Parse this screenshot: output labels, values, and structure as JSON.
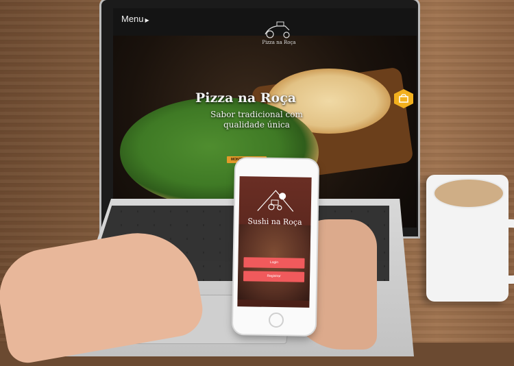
{
  "desktop_site": {
    "menu_label": "Menu",
    "brand": "Pizza na Roça",
    "hero_title": "Pizza na Roça",
    "hero_subtitle": "Sabor tradicional com qualidade única",
    "cta_label": "MONTE SUA PIZZA"
  },
  "mobile_app": {
    "brand": "Sushi na Roça",
    "login_label": "Login",
    "register_label": "Registrar"
  },
  "colors": {
    "accent": "#e39a2a",
    "mobile_button": "#f05a5c"
  }
}
